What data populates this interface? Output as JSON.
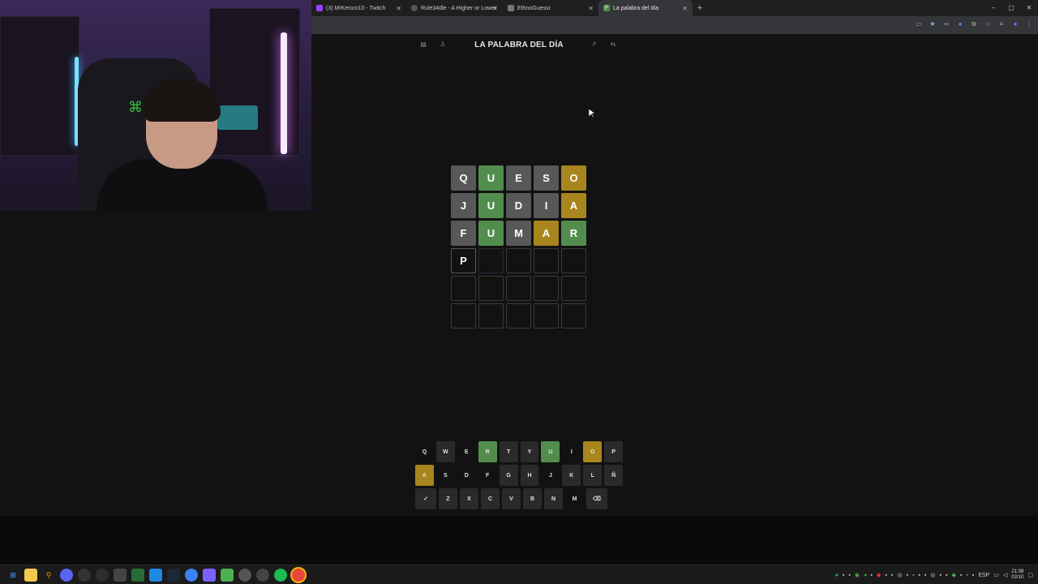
{
  "browser": {
    "tabs": [
      {
        "label": "(3) MrKeroro10 - Twitch",
        "icon": "twitch-icon",
        "active": false
      },
      {
        "label": "Rule34dle - A Higher or Lower",
        "icon": "globe-icon",
        "active": false
      },
      {
        "label": "EthnoGuessr",
        "icon": "page-icon",
        "active": false
      },
      {
        "label": "La palabra del día",
        "icon": "p-icon",
        "active": true
      }
    ],
    "new_tab": "+",
    "window_controls": [
      "–",
      "▢",
      "✕"
    ]
  },
  "game": {
    "title": "LA PALABRA DEL DÍA",
    "header_icons": [
      "menu-icon",
      "user-icon",
      "stats-icon",
      "swap-icon"
    ]
  },
  "board": [
    [
      {
        "l": "Q",
        "s": "x"
      },
      {
        "l": "U",
        "s": "g"
      },
      {
        "l": "E",
        "s": "x"
      },
      {
        "l": "S",
        "s": "x"
      },
      {
        "l": "O",
        "s": "y"
      }
    ],
    [
      {
        "l": "J",
        "s": "x"
      },
      {
        "l": "U",
        "s": "g"
      },
      {
        "l": "D",
        "s": "x"
      },
      {
        "l": "I",
        "s": "x"
      },
      {
        "l": "A",
        "s": "y"
      }
    ],
    [
      {
        "l": "F",
        "s": "x"
      },
      {
        "l": "U",
        "s": "g"
      },
      {
        "l": "M",
        "s": "x"
      },
      {
        "l": "A",
        "s": "y"
      },
      {
        "l": "R",
        "s": "g"
      }
    ],
    [
      {
        "l": "P",
        "s": "f"
      },
      {
        "l": "",
        "s": "cur"
      },
      {
        "l": "",
        "s": "e"
      },
      {
        "l": "",
        "s": "e"
      },
      {
        "l": "",
        "s": "e"
      }
    ],
    [
      {
        "l": "",
        "s": "e"
      },
      {
        "l": "",
        "s": "e"
      },
      {
        "l": "",
        "s": "e"
      },
      {
        "l": "",
        "s": "e"
      },
      {
        "l": "",
        "s": "e"
      }
    ],
    [
      {
        "l": "",
        "s": "e"
      },
      {
        "l": "",
        "s": "e"
      },
      {
        "l": "",
        "s": "e"
      },
      {
        "l": "",
        "s": "e"
      },
      {
        "l": "",
        "s": "e"
      }
    ]
  ],
  "keyboard": [
    [
      {
        "k": "Q",
        "s": "used"
      },
      {
        "k": "W",
        "s": ""
      },
      {
        "k": "E",
        "s": "used"
      },
      {
        "k": "R",
        "s": "g"
      },
      {
        "k": "T",
        "s": ""
      },
      {
        "k": "Y",
        "s": ""
      },
      {
        "k": "U",
        "s": "g"
      },
      {
        "k": "I",
        "s": "used"
      },
      {
        "k": "O",
        "s": "y"
      },
      {
        "k": "P",
        "s": ""
      }
    ],
    [
      {
        "k": "A",
        "s": "y"
      },
      {
        "k": "S",
        "s": "used"
      },
      {
        "k": "D",
        "s": "used"
      },
      {
        "k": "F",
        "s": "used"
      },
      {
        "k": "G",
        "s": ""
      },
      {
        "k": "H",
        "s": ""
      },
      {
        "k": "J",
        "s": "used"
      },
      {
        "k": "K",
        "s": ""
      },
      {
        "k": "L",
        "s": ""
      },
      {
        "k": "Ñ",
        "s": ""
      }
    ],
    [
      {
        "k": "✓",
        "s": ""
      },
      {
        "k": "Z",
        "s": ""
      },
      {
        "k": "X",
        "s": ""
      },
      {
        "k": "C",
        "s": ""
      },
      {
        "k": "V",
        "s": ""
      },
      {
        "k": "B",
        "s": ""
      },
      {
        "k": "N",
        "s": ""
      },
      {
        "k": "M",
        "s": "used"
      },
      {
        "k": "⌫",
        "s": ""
      }
    ]
  ],
  "taskbar": {
    "language": "ESP",
    "time": "21:08",
    "date": "02/10"
  },
  "colors": {
    "correct": "#538d4e",
    "present": "#a8851d",
    "absent": "#585858"
  }
}
